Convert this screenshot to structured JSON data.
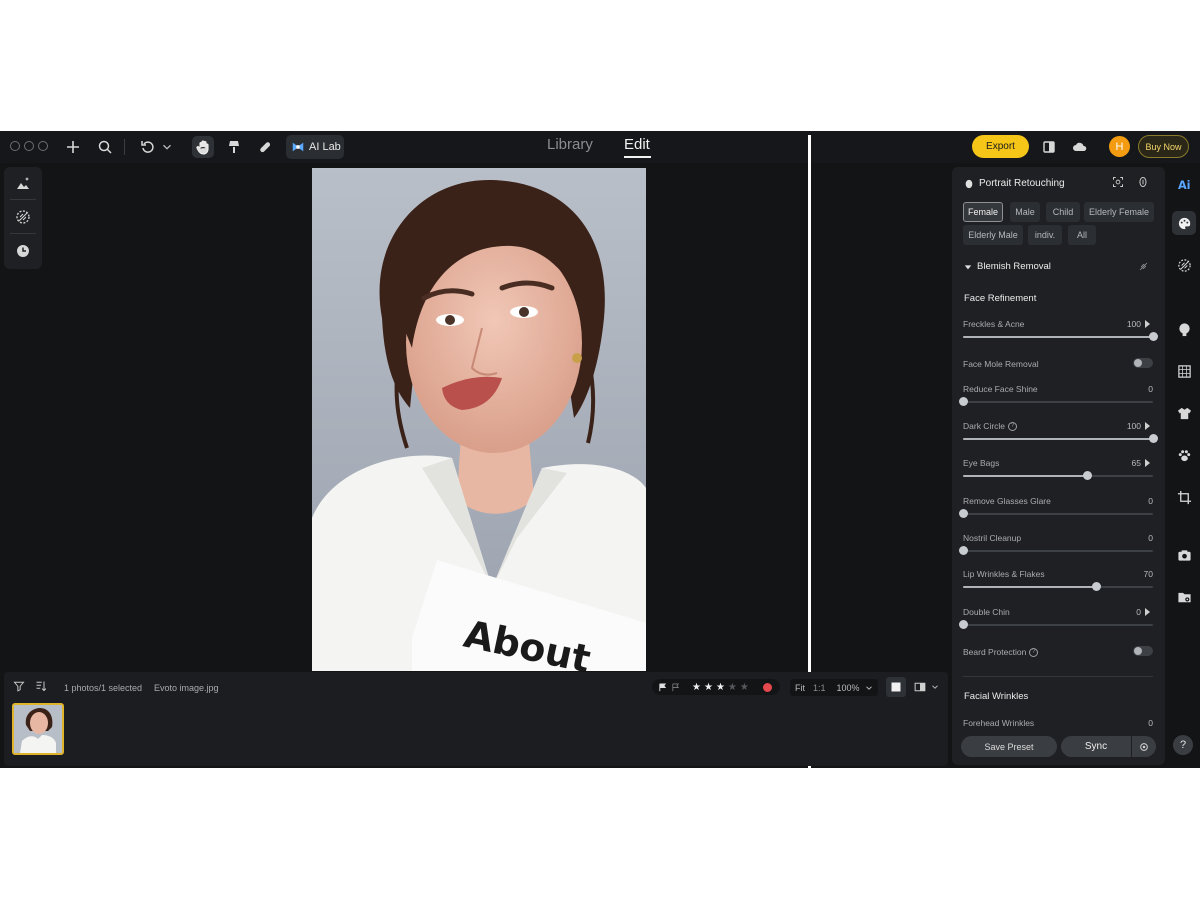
{
  "topbar": {
    "ai_lab_label": "AI Lab",
    "tabs": [
      {
        "label": "Library"
      },
      {
        "label": "Edit"
      }
    ],
    "export_label": "Export",
    "avatar_initial": "H",
    "buy_now_label": "Buy Now"
  },
  "filmstrip": {
    "selection_text": "1 photos/1 selected",
    "filename": "Evoto image.jpg",
    "rating_stars": 3,
    "rating_max": 5,
    "zoom": {
      "fit": "Fit",
      "one_to_one": "1:1",
      "level": "100%"
    }
  },
  "photo": {
    "magazine_text": "About"
  },
  "panel": {
    "title": "Portrait Retouching",
    "presets": [
      {
        "label": "Female",
        "active": true
      },
      {
        "label": "Male"
      },
      {
        "label": "Child"
      },
      {
        "label": "Elderly Female"
      },
      {
        "label": "Elderly Male"
      },
      {
        "label": "indiv."
      },
      {
        "label": "All"
      }
    ],
    "section_title": "Blemish Removal",
    "subsection_title": "Face Refinement",
    "sliders": [
      {
        "label": "Freckles & Acne",
        "value": 100,
        "arrow": true
      },
      {
        "label": "Face Mole Removal",
        "type": "toggle"
      },
      {
        "label": "Reduce Face Shine",
        "value": 0
      },
      {
        "label": "Dark Circle",
        "value": 100,
        "arrow": true,
        "help": true
      },
      {
        "label": "Eye Bags",
        "value": 65,
        "arrow": true
      },
      {
        "label": "Remove Glasses Glare",
        "value": 0
      },
      {
        "label": "Nostril Cleanup",
        "value": 0
      },
      {
        "label": "Lip Wrinkles & Flakes",
        "value": 70
      },
      {
        "label": "Double Chin",
        "value": 0,
        "arrow": true
      },
      {
        "label": "Beard Protection",
        "type": "toggle",
        "help": true
      }
    ],
    "facial_wrinkles_title": "Facial Wrinkles",
    "forehead_label": "Forehead Wrinkles",
    "forehead_value": 0,
    "save_preset_label": "Save Preset",
    "sync_label": "Sync"
  },
  "colors": {
    "accent": "#f5c518",
    "avatar": "#f39c12",
    "flag_red": "#e5484d",
    "background": "#121416",
    "panel": "#1e2023"
  }
}
